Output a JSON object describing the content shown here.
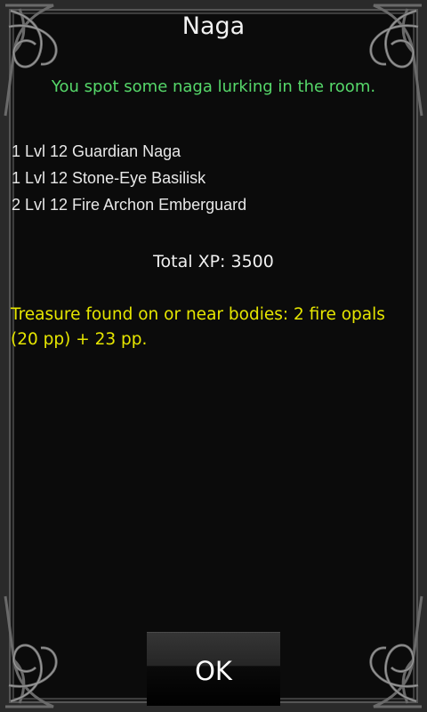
{
  "dialog": {
    "title": "Naga",
    "intro": "You spot some naga lurking in the room.",
    "monsters": [
      "1 Lvl 12 Guardian Naga",
      "1 Lvl 12 Stone-Eye Basilisk",
      "2 Lvl 12 Fire Archon Emberguard"
    ],
    "total_xp": "Total XP: 3500",
    "treasure_line1": "Treasure found on or near bodies: 2 fire opals",
    "treasure_line2": "(20 pp) + 23 pp.",
    "ok_label": "OK"
  },
  "colors": {
    "intro": "#56d86a",
    "treasure": "#e6e600",
    "text": "#e8e8e8",
    "background": "#0b0b0b"
  },
  "icons": {
    "frame_corner": "ornate-knot-corner-icon"
  }
}
